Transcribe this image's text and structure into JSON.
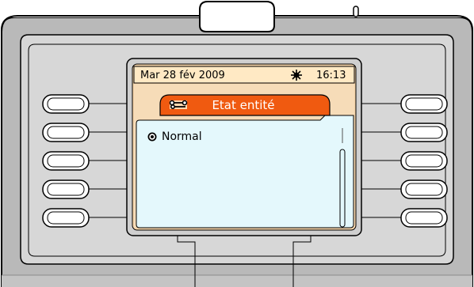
{
  "status_bar": {
    "date": "Mar 28 fév 2009",
    "time": "16:13",
    "indicator_icon": "sun-icon"
  },
  "header": {
    "icon": "wrench-icon",
    "title": "Etat entité"
  },
  "list": {
    "items": [
      {
        "label": "Normal",
        "selected": true,
        "icon": "radio-selected-icon"
      }
    ],
    "scrollbar_icon": "scrollbar-icon"
  },
  "softkeys": {
    "left_count": 5,
    "right_count": 5
  },
  "colors": {
    "housing": "#b9b9b9",
    "bezel": "#d7d7d7",
    "status_bar": "#ffe9c4",
    "header_tab": "#f05a10",
    "screen_frame": "#f4d3a9",
    "list_background": "#e4f8fc",
    "top_band": "#ffffff"
  }
}
